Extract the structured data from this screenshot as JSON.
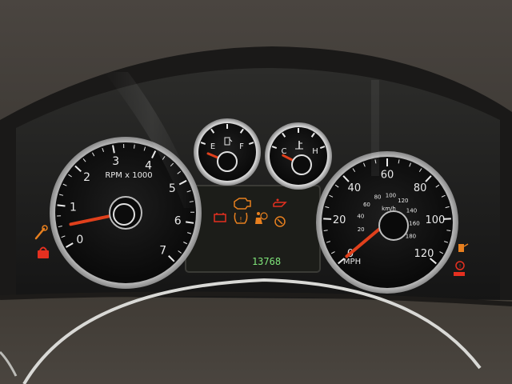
{
  "tachometer": {
    "unit_label": "RPM x 1000",
    "tick_labels": [
      "0",
      "1",
      "2",
      "3",
      "4",
      "5",
      "6",
      "7"
    ],
    "needle_value": 0.5
  },
  "speedometer": {
    "unit_label": "MPH",
    "mph_labels": [
      "0",
      "20",
      "40",
      "60",
      "80",
      "100",
      "120"
    ],
    "kmh_label": "km/h",
    "kmh_labels": [
      "20",
      "40",
      "60",
      "80",
      "100",
      "120",
      "140",
      "160",
      "180"
    ],
    "needle_value": 0
  },
  "fuel_gauge": {
    "empty_label": "E",
    "full_label": "F",
    "level": 0.02
  },
  "temp_gauge": {
    "cold_label": "C",
    "hot_label": "H",
    "level": 0.05
  },
  "odometer": {
    "value": "13768"
  },
  "warning_lights": [
    {
      "icon": "check-engine-icon",
      "color": "#e8801f"
    },
    {
      "icon": "oil-pressure-icon",
      "color": "#e53020"
    },
    {
      "icon": "battery-icon",
      "color": "#e53020"
    },
    {
      "icon": "tire-pressure-icon",
      "color": "#e8801f"
    },
    {
      "icon": "airbag-icon",
      "color": "#e8801f"
    },
    {
      "icon": "traction-control-icon",
      "color": "#e8801f"
    },
    {
      "icon": "wrench-icon",
      "color": "#e8801f"
    },
    {
      "icon": "security-lock-icon",
      "color": "#e53020"
    },
    {
      "icon": "brake-warning-icon",
      "color": "#e53020"
    },
    {
      "icon": "fuel-door-icon",
      "color": "#e8801f"
    }
  ],
  "colors": {
    "dial_face": "#111111",
    "dial_ring": "#c8c8c8",
    "needle": "#e0401c",
    "odometer_green": "#7fe57a",
    "warning_red": "#e53020",
    "warning_amber": "#e8801f"
  }
}
